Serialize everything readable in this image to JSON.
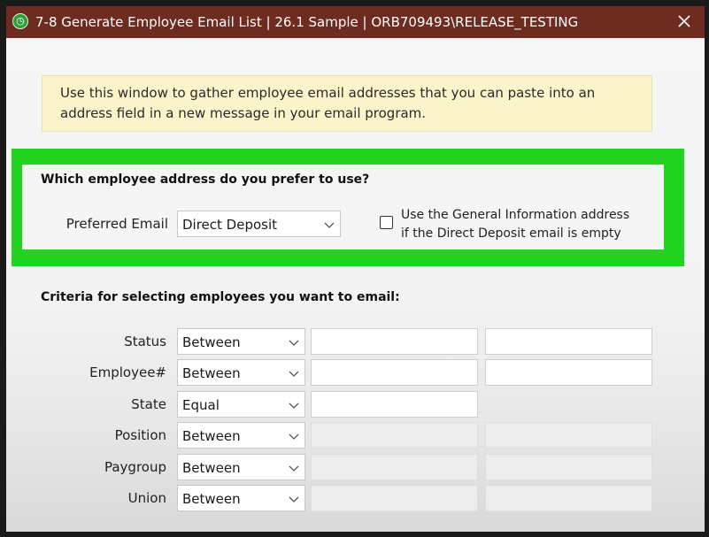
{
  "titlebar": {
    "icon_glyph": "◷",
    "title": "7-8 Generate Employee Email List | 26.1 Sample | ORB709493\\RELEASE_TESTING",
    "close_glyph": "✕"
  },
  "info": {
    "line1": "Use this window to gather employee email addresses that you can paste into an",
    "line2": "address field in a new message in your email program."
  },
  "preference": {
    "heading": "Which employee address do you prefer to use?",
    "preferred_email_label": "Preferred Email",
    "preferred_email_value": "Direct Deposit",
    "fallback_checked": false,
    "fallback_line1": "Use the General Information address",
    "fallback_line2": "if the Direct Deposit email is empty"
  },
  "criteria": {
    "heading": "Criteria for selecting employees you want to email:",
    "rows": [
      {
        "label": "Status",
        "operator": "Between"
      },
      {
        "label": "Employee#",
        "operator": "Between"
      },
      {
        "label": "State",
        "operator": "Equal"
      },
      {
        "label": "Position",
        "operator": "Between"
      },
      {
        "label": "Paygroup",
        "operator": "Between"
      },
      {
        "label": "Union",
        "operator": "Between"
      }
    ]
  },
  "colors": {
    "titlebar": "#6e2b1f",
    "highlight_frame": "#22d31f",
    "info_background": "#fbf3c9"
  }
}
